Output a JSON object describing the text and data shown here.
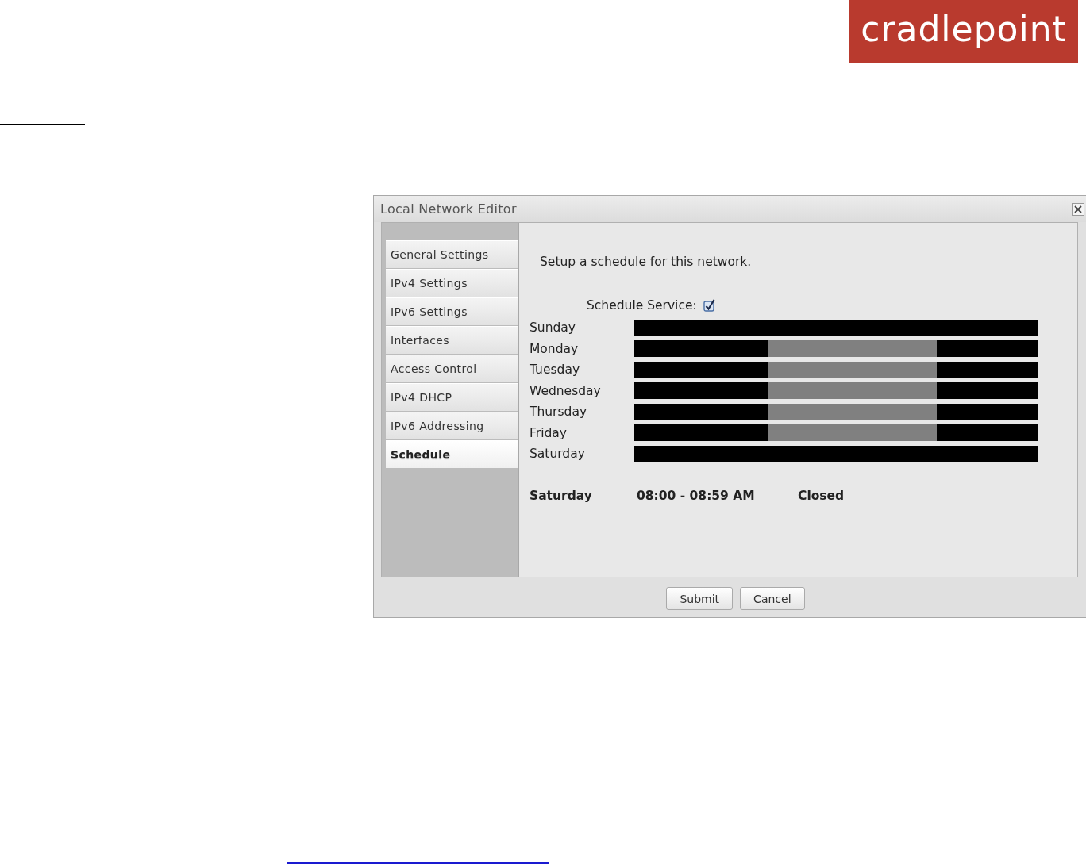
{
  "logo": {
    "text": "cradlepoint"
  },
  "dialog": {
    "title": "Local Network Editor",
    "tabs": [
      {
        "label": "General Settings",
        "selected": false
      },
      {
        "label": "IPv4 Settings",
        "selected": false
      },
      {
        "label": "IPv6 Settings",
        "selected": false
      },
      {
        "label": "Interfaces",
        "selected": false
      },
      {
        "label": "Access Control",
        "selected": false
      },
      {
        "label": "IPv4 DHCP",
        "selected": false
      },
      {
        "label": "IPv6 Addressing",
        "selected": false
      },
      {
        "label": "Schedule",
        "selected": true
      }
    ],
    "intro": "Setup a schedule for this network.",
    "schedule_service": {
      "label": "Schedule Service:",
      "checked": true
    },
    "days": [
      {
        "name": "Sunday",
        "hours": [
          false,
          false,
          false,
          false,
          false,
          false,
          false,
          false,
          false,
          false,
          false,
          false,
          false,
          false,
          false,
          false,
          false,
          false,
          false,
          false,
          false,
          false,
          false,
          false
        ]
      },
      {
        "name": "Monday",
        "hours": [
          false,
          false,
          false,
          false,
          false,
          false,
          false,
          false,
          true,
          true,
          true,
          true,
          true,
          true,
          true,
          true,
          true,
          true,
          false,
          false,
          false,
          false,
          false,
          false
        ]
      },
      {
        "name": "Tuesday",
        "hours": [
          false,
          false,
          false,
          false,
          false,
          false,
          false,
          false,
          true,
          true,
          true,
          true,
          true,
          true,
          true,
          true,
          true,
          true,
          false,
          false,
          false,
          false,
          false,
          false
        ]
      },
      {
        "name": "Wednesday",
        "hours": [
          false,
          false,
          false,
          false,
          false,
          false,
          false,
          false,
          true,
          true,
          true,
          true,
          true,
          true,
          true,
          true,
          true,
          true,
          false,
          false,
          false,
          false,
          false,
          false
        ]
      },
      {
        "name": "Thursday",
        "hours": [
          false,
          false,
          false,
          false,
          false,
          false,
          false,
          false,
          true,
          true,
          true,
          true,
          true,
          true,
          true,
          true,
          true,
          true,
          false,
          false,
          false,
          false,
          false,
          false
        ]
      },
      {
        "name": "Friday",
        "hours": [
          false,
          false,
          false,
          false,
          false,
          false,
          false,
          false,
          true,
          true,
          true,
          true,
          true,
          true,
          true,
          true,
          true,
          true,
          false,
          false,
          false,
          false,
          false,
          false
        ]
      },
      {
        "name": "Saturday",
        "hours": [
          false,
          false,
          false,
          false,
          false,
          false,
          false,
          false,
          false,
          false,
          false,
          false,
          false,
          false,
          false,
          false,
          false,
          false,
          false,
          false,
          false,
          false,
          false,
          false
        ]
      }
    ],
    "hover_info": {
      "day": "Saturday",
      "time": "08:00 - 08:59 AM",
      "status": "Closed"
    },
    "buttons": [
      "Submit",
      "Cancel"
    ]
  }
}
